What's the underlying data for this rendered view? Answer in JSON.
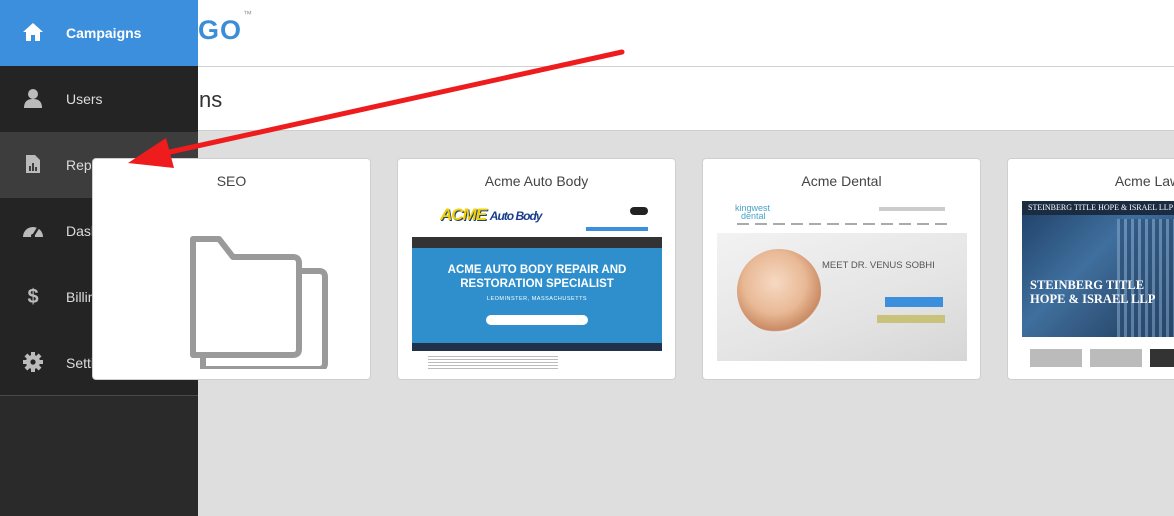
{
  "app": {
    "logo_text": "GO",
    "logo_tm": "™",
    "page_title": "ns",
    "accent_color": "#3c8fdd",
    "pointer_arrow_color": "#ee1c1c"
  },
  "sidebar": {
    "items": [
      {
        "label": "Campaigns",
        "icon": "home-icon",
        "state": "active"
      },
      {
        "label": "Users",
        "icon": "user-icon",
        "state": "normal"
      },
      {
        "label": "Reports",
        "icon": "report-icon",
        "state": "hover"
      },
      {
        "label": "Dashboards",
        "icon": "dashboard-gauge-icon",
        "state": "normal"
      },
      {
        "label": "Billing",
        "icon": "dollar-icon",
        "state": "normal"
      },
      {
        "label": "Settings",
        "icon": "gear-icon",
        "state": "normal"
      }
    ]
  },
  "campaigns": [
    {
      "title": "SEO",
      "thumbnail": "folder-icon"
    },
    {
      "title": "Acme Auto Body",
      "thumbnail": "website-screenshot",
      "shot": {
        "logo": "ACME",
        "logo_script": "Auto Body",
        "headline_1": "ACME AUTO BODY REPAIR AND",
        "headline_2": "RESTORATION SPECIALIST",
        "location": "LEOMINSTER, MASSACHUSETTS"
      }
    },
    {
      "title": "Acme Dental",
      "thumbnail": "website-screenshot",
      "shot": {
        "logo_1": "kingwest",
        "logo_2": "dental",
        "headline": "MEET DR. VENUS SOBHI"
      }
    },
    {
      "title": "Acme Law",
      "thumbnail": "website-screenshot",
      "shot": {
        "top_banner": "STEINBERG TITLE HOPE & ISRAEL LLP",
        "name_1": "STEINBERG TITLE",
        "name_2": "HOPE & ISRAEL LLP"
      }
    }
  ]
}
